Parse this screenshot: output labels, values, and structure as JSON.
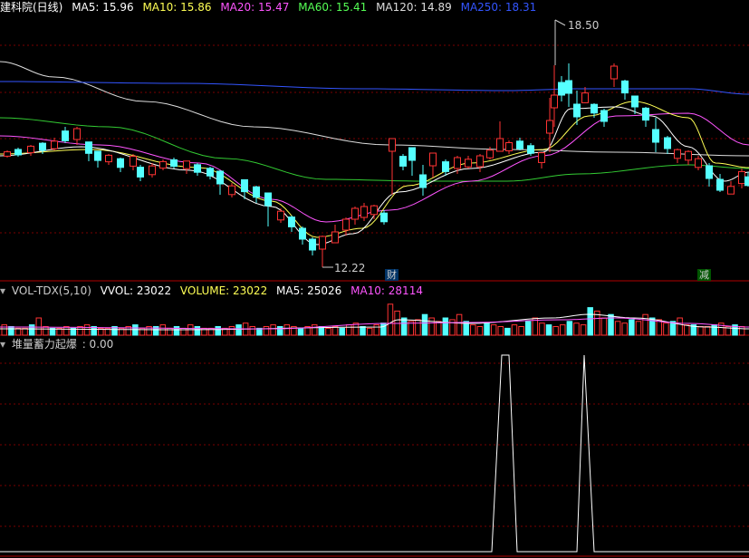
{
  "main": {
    "title": "建科院(日线)",
    "indicators": [
      {
        "label": "MA5: 15.96",
        "color": "#ffffff"
      },
      {
        "label": "MA10: 15.86",
        "color": "#ffff55"
      },
      {
        "label": "MA20: 15.47",
        "color": "#ff55ff"
      },
      {
        "label": "MA60: 15.41",
        "color": "#55ff55"
      },
      {
        "label": "MA120: 14.89",
        "color": "#dddddd"
      },
      {
        "label": "MA250: 18.31",
        "color": "#3355ff"
      }
    ],
    "high_label": "18.50",
    "low_label": "12.22",
    "badges": {
      "finance": "财",
      "reduce": "减"
    }
  },
  "volume": {
    "title": "VOL-TDX(5,10)",
    "values": [
      {
        "label": "VVOL: 23022",
        "color": "#ffffff"
      },
      {
        "label": "VOLUME: 23022",
        "color": "#ffff55"
      },
      {
        "label": "MA5: 25026",
        "color": "#ffffff"
      },
      {
        "label": "MA10: 28114",
        "color": "#ff55ff"
      }
    ]
  },
  "signal": {
    "title": "堆量蓄力起爆",
    "value": ": 0.00"
  },
  "colors": {
    "up": "#ff3333",
    "down": "#55ffff",
    "grid": "#7a0000",
    "divider": "#b00000"
  }
}
